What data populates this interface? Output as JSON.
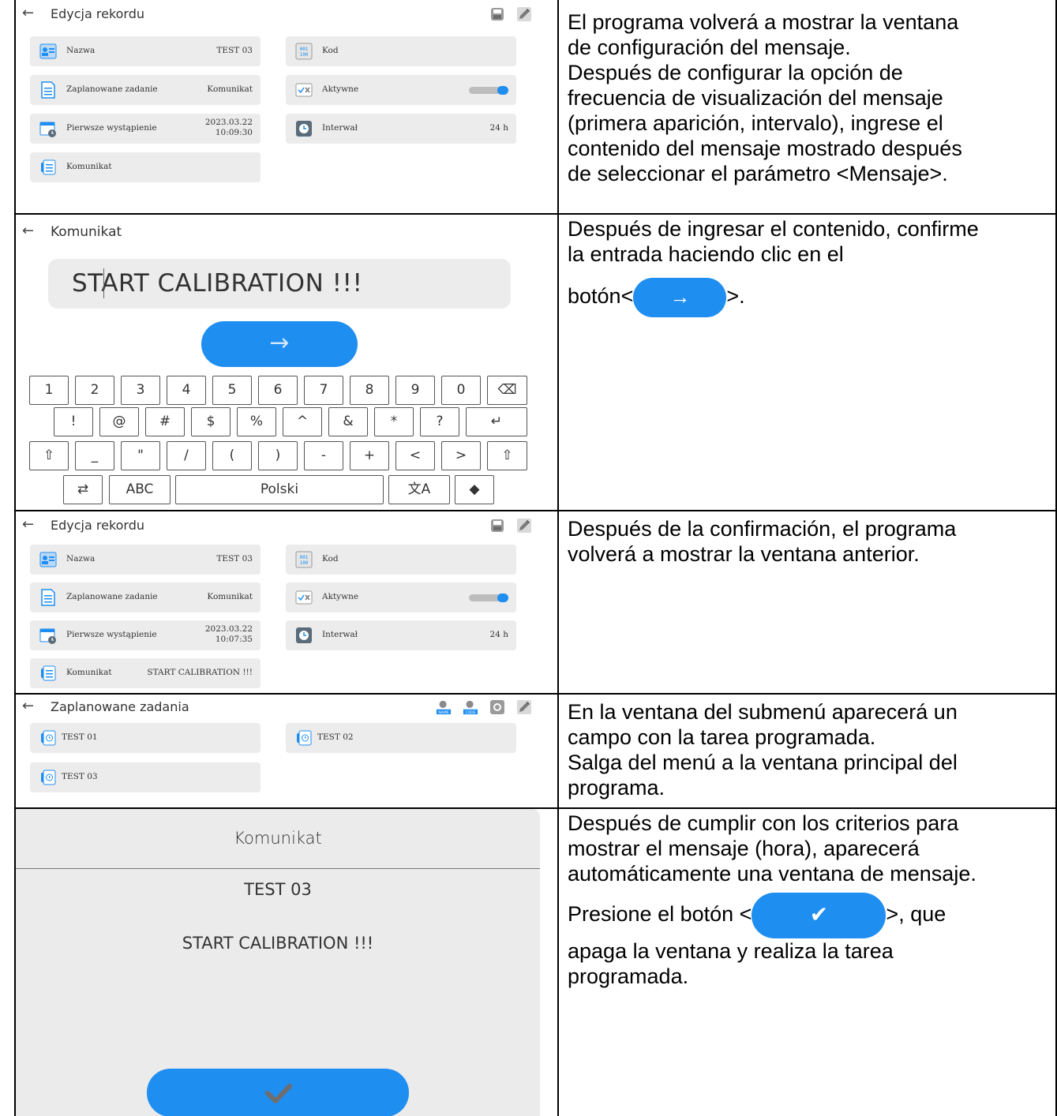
{
  "rows": [
    {
      "screen": {
        "back_glyph": "←",
        "title": "Edycja rekordu",
        "tools": [
          "save-icon",
          "edit-icon"
        ],
        "cards": [
          {
            "label": "Nazwa",
            "value": "TEST 03",
            "icon": "id-card-icon"
          },
          {
            "label": "Kod",
            "value": "",
            "icon": "barcode-icon"
          },
          {
            "label": "Zaplanowane zadanie",
            "value": "Komunikat",
            "icon": "document-icon"
          },
          {
            "label": "Aktywne",
            "value": "",
            "icon": "checkbox-icon",
            "toggle_on": true
          },
          {
            "label": "Pierwsze wystąpienie",
            "value_line1": "2023.03.22",
            "value_line2": "10:09:30",
            "icon": "calendar-clock-icon"
          },
          {
            "label": "Interwał",
            "value": "24 h",
            "icon": "clock-icon"
          },
          {
            "label": "Komunikat",
            "value": "",
            "icon": "message-icon"
          }
        ]
      },
      "description": [
        "El programa volverá a mostrar la ventana",
        "de configuración del mensaje.",
        "Después de configurar la opción de",
        "frecuencia de visualización del mensaje",
        "(primera aparición, intervalo), ingrese el",
        "contenido del mensaje mostrado después",
        "de seleccionar el parámetro <Mensaje>."
      ]
    },
    {
      "screen": {
        "back_glyph": "←",
        "title": "Komunikat",
        "input_value": "START CALIBRATION !!!",
        "go_glyph": "→",
        "keys_row1": [
          "1",
          "2",
          "3",
          "4",
          "5",
          "6",
          "7",
          "8",
          "9",
          "0",
          "⌫"
        ],
        "keys_row2": [
          "!",
          "@",
          "#",
          "$",
          "%",
          "^",
          "&",
          "*",
          "?",
          "↵"
        ],
        "keys_row3": [
          "⇧",
          "_",
          "\"",
          "/",
          "(",
          ")",
          "-",
          "+",
          "<",
          ">",
          "⇧"
        ],
        "keys_row4": [
          "⇄",
          "ABC",
          "Polski",
          "文A",
          "◆"
        ]
      },
      "description_lines": [
        "Después de ingresar el contenido, confirme",
        "la entrada haciendo clic en el"
      ],
      "description_btn_prefix": "botón<",
      "description_btn_glyph": "→",
      "description_btn_suffix": ">."
    },
    {
      "screen": {
        "back_glyph": "←",
        "title": "Edycja rekordu",
        "tools": [
          "save-icon",
          "edit-icon"
        ],
        "cards": [
          {
            "label": "Nazwa",
            "value": "TEST 03",
            "icon": "id-card-icon"
          },
          {
            "label": "Kod",
            "value": "",
            "icon": "barcode-icon"
          },
          {
            "label": "Zaplanowane zadanie",
            "value": "Komunikat",
            "icon": "document-icon"
          },
          {
            "label": "Aktywne",
            "value": "",
            "icon": "checkbox-icon",
            "toggle_on": true
          },
          {
            "label": "Pierwsze wystąpienie",
            "value_line1": "2023.03.22",
            "value_line2": "10:07:35",
            "icon": "calendar-clock-icon"
          },
          {
            "label": "Interwał",
            "value": "24 h",
            "icon": "clock-icon"
          },
          {
            "label": "Komunikat",
            "value": "START CALIBRATION !!!",
            "icon": "message-icon"
          }
        ]
      },
      "description": [
        "Después de la confirmación, el programa",
        "volverá a mostrar la ventana anterior."
      ]
    },
    {
      "screen": {
        "back_glyph": "←",
        "title": "Zaplanowane zadania",
        "tools": [
          "search-name-icon",
          "search-code-icon",
          "add-icon",
          "edit-icon"
        ],
        "tool_labels": [
          "NAME",
          "CODE"
        ],
        "items": [
          "TEST 01",
          "TEST 02",
          "TEST 03"
        ]
      },
      "description": [
        "En la ventana del submenú aparecerá un",
        "campo con la tarea programada.",
        "Salga del menú a la ventana principal del",
        "programa."
      ]
    },
    {
      "screen": {
        "title": "Komunikat",
        "name": "TEST 03",
        "message": "START CALIBRATION !!!",
        "ok_glyph": "✔"
      },
      "description_lines": [
        "Después de cumplir con los criterios para",
        "mostrar el mensaje (hora), aparecerá",
        "automáticamente una ventana de mensaje."
      ],
      "description_btn_prefix": "Presione el botón <",
      "description_btn_glyph": "✔",
      "description_btn_suffix": ">, que",
      "description_tail": [
        "apaga la ventana y realiza la tarea",
        "programada."
      ]
    }
  ],
  "colors": {
    "accent": "#1f8ef1",
    "card_bg": "#ececec",
    "border": "#000000"
  }
}
